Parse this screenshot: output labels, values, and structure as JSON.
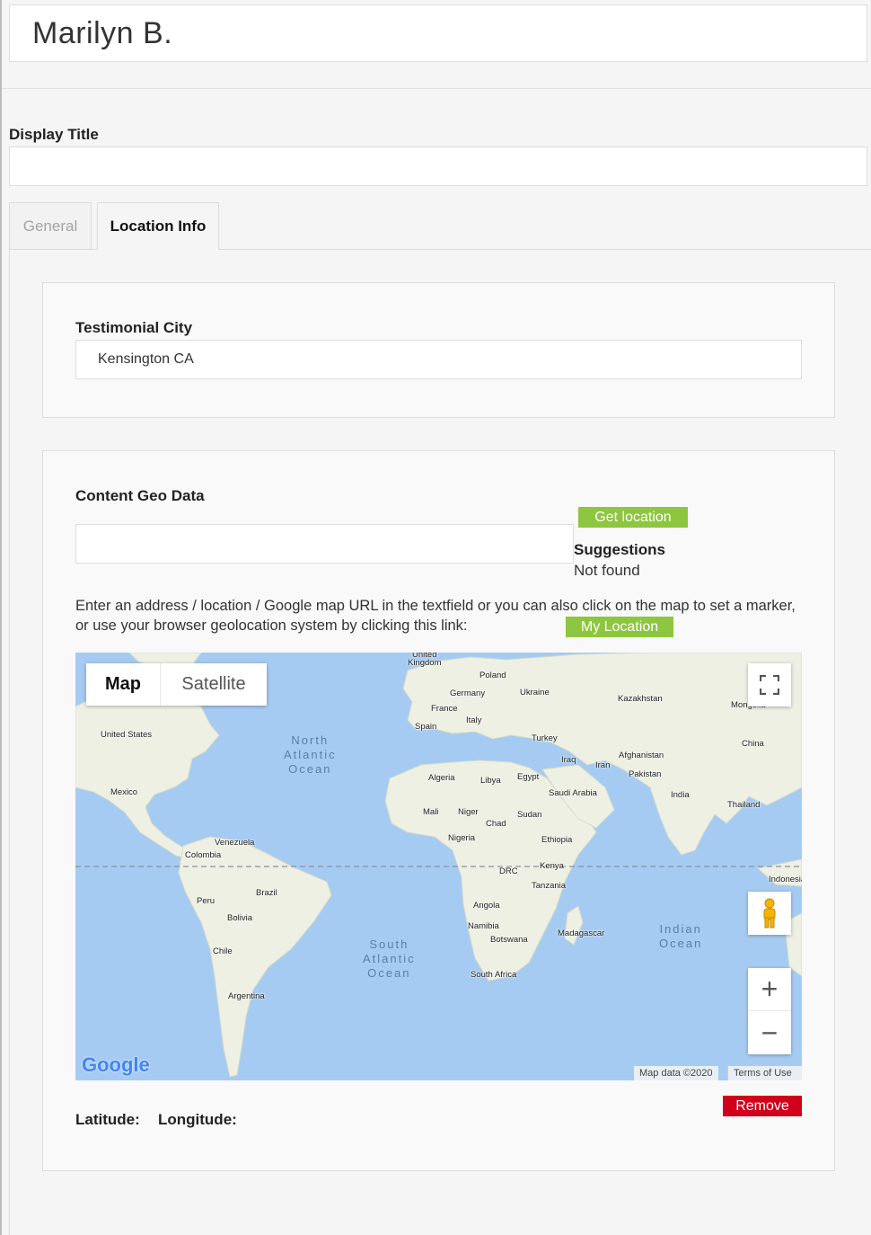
{
  "header": {
    "title": "Marilyn B."
  },
  "display_title": {
    "label": "Display Title",
    "value": ""
  },
  "tabs": [
    {
      "label": "General"
    },
    {
      "label": "Location Info"
    }
  ],
  "testimonial_city": {
    "label": "Testimonial City",
    "value": "Kensington CA"
  },
  "geo": {
    "label": "Content Geo Data",
    "address_value": "",
    "get_location_label": "Get location",
    "suggestions_title": "Suggestions",
    "suggestions_status": "Not found",
    "help_text": "Enter an address / location / Google map URL in the textfield or you can also click on the map to set a marker, or use your browser geolocation system by clicking this link:",
    "my_location_label": "My Location",
    "remove_label": "Remove",
    "latitude_label": "Latitude:",
    "longitude_label": "Longitude:"
  },
  "map": {
    "type_map": "Map",
    "type_satellite": "Satellite",
    "logo": "Google",
    "map_data": "Map data ©2020",
    "terms": "Terms of Use",
    "zoom_in": "+",
    "zoom_out": "−",
    "oceans": {
      "north_atlantic": "North\nAtlantic\nOcean",
      "south_atlantic": "South\nAtlantic\nOcean",
      "indian": "Indian\nOcean"
    },
    "places": {
      "uk": "United\nKingdom",
      "poland": "Poland",
      "germany": "Germany",
      "ukraine": "Ukraine",
      "kazakhstan": "Kazakhstan",
      "mongolia": "Mongolia",
      "france": "France",
      "italy": "Italy",
      "spain": "Spain",
      "turkey": "Turkey",
      "china": "China",
      "us": "United States",
      "afghanistan": "Afghanistan",
      "iraq": "Iraq",
      "iran": "Iran",
      "pakistan": "Pakistan",
      "algeria": "Algeria",
      "libya": "Libya",
      "egypt": "Egypt",
      "saudi": "Saudi Arabia",
      "india": "India",
      "mexico": "Mexico",
      "thailand": "Thailand",
      "mali": "Mali",
      "niger": "Niger",
      "chad": "Chad",
      "sudan": "Sudan",
      "nigeria": "Nigeria",
      "ethiopia": "Ethiopia",
      "venezuela": "Venezuela",
      "colombia": "Colombia",
      "drc": "DRC",
      "kenya": "Kenya",
      "indonesia": "Indonesia",
      "tanzania": "Tanzania",
      "peru": "Peru",
      "brazil": "Brazil",
      "angola": "Angola",
      "bolivia": "Bolivia",
      "namibia": "Namibia",
      "madagascar": "Madagascar",
      "botswana": "Botswana",
      "chile": "Chile",
      "south_africa": "South Africa",
      "argentina": "Argentina"
    }
  },
  "colors": {
    "accent_green": "#8dc63f",
    "remove_red": "#d0021b",
    "ocean": "#a6cbf2",
    "land": "#eef0e4"
  },
  "icons": [
    "fullscreen-icon",
    "pegman-icon",
    "zoom-in-icon",
    "zoom-out-icon"
  ]
}
